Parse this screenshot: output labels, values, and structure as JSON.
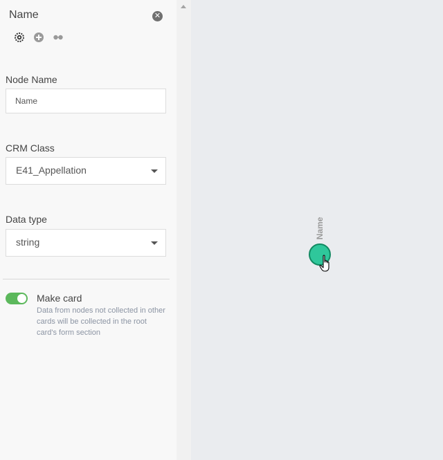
{
  "panel": {
    "title": "Name",
    "close_icon": "close-icon",
    "tools": [
      "gear-icon",
      "plus-circle-icon",
      "link-nodes-icon"
    ]
  },
  "fields": {
    "node_name": {
      "label": "Node Name",
      "value": "Name"
    },
    "crm_class": {
      "label": "CRM Class",
      "value": "E41_Appellation"
    },
    "data_type": {
      "label": "Data type",
      "value": "string"
    }
  },
  "make_card": {
    "label": "Make card",
    "enabled": true,
    "help": "Data from nodes not collected in other cards will be collected in the root card's form section"
  },
  "graph": {
    "node_label": "Name",
    "node_color": "#2fc79b"
  },
  "colors": {
    "toggle_on": "#5cb85c",
    "help_text": "#8b94a3"
  }
}
